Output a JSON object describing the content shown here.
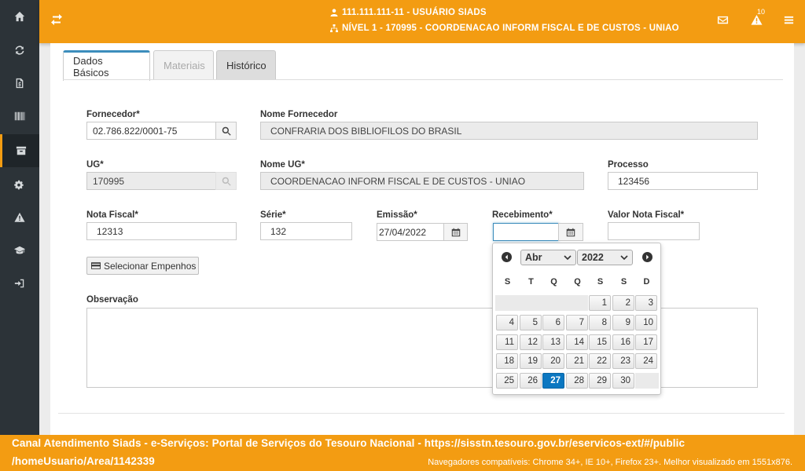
{
  "colors": {
    "header": "#f39c12",
    "sidebar": "#2c3338",
    "accent": "#3c8dbc",
    "today": "#0b77c1"
  },
  "sidebar": {
    "items": [
      {
        "icon": "home-icon"
      },
      {
        "icon": "refresh-icon"
      },
      {
        "icon": "document-money-icon"
      },
      {
        "icon": "barcode-icon"
      },
      {
        "icon": "archive-box-icon",
        "active": true
      },
      {
        "icon": "cogs-icon"
      },
      {
        "icon": "warning-icon"
      },
      {
        "icon": "graduation-cap-icon"
      },
      {
        "icon": "sign-in-icon"
      }
    ]
  },
  "header": {
    "user_line": "111.111.111-11 - USUÁRIO SIADS",
    "level_line": "NÍVEL 1 - 170995 - COORDENACAO INFORM FISCAL E DE CUSTOS - UNIAO",
    "alert_count": "10"
  },
  "tabs": [
    {
      "label": "Dados Básicos",
      "state": "active"
    },
    {
      "label": "Materiais",
      "state": "disabled"
    },
    {
      "label": "Histórico",
      "state": "normal"
    }
  ],
  "form": {
    "fornecedor": {
      "label": "Fornecedor*",
      "value": "02.786.822/0001-75"
    },
    "nome_fornecedor": {
      "label": "Nome Fornecedor",
      "value": "CONFRARIA DOS BIBLIOFILOS DO BRASIL"
    },
    "ug": {
      "label": "UG*",
      "value": "170995"
    },
    "nome_ug": {
      "label": "Nome UG*",
      "value": "COORDENACAO INFORM FISCAL E DE CUSTOS - UNIAO"
    },
    "processo": {
      "label": "Processo",
      "value": "123456"
    },
    "nota_fiscal": {
      "label": "Nota Fiscal*",
      "value": "12313"
    },
    "serie": {
      "label": "Série*",
      "value": "132"
    },
    "emissao": {
      "label": "Emissão*",
      "value": "27/04/2022"
    },
    "recebimento": {
      "label": "Recebimento*",
      "value": ""
    },
    "valor_nota": {
      "label": "Valor Nota Fiscal*",
      "value": ""
    },
    "selecionar_empenhos": "Selecionar Empenhos",
    "observacao": {
      "label": "Observação",
      "value": ""
    }
  },
  "datepicker": {
    "month": "Abr",
    "year": "2022",
    "weekdays": [
      "S",
      "T",
      "Q",
      "Q",
      "S",
      "S",
      "D"
    ],
    "leading_blanks": 4,
    "days": [
      "1",
      "2",
      "3",
      "4",
      "5",
      "6",
      "7",
      "8",
      "9",
      "10",
      "11",
      "12",
      "13",
      "14",
      "15",
      "16",
      "17",
      "18",
      "19",
      "20",
      "21",
      "22",
      "23",
      "24",
      "25",
      "26",
      "27",
      "28",
      "29",
      "30"
    ],
    "today": "27"
  },
  "footer": {
    "line1": "Canal Atendimento Siads - e-Serviços: Portal de Serviços do Tesouro Nacional - https://sisstn.tesouro.gov.br/eservicos-ext/#/public",
    "line2": "/homeUsuario/Area/1142339",
    "compat": "Navegadores compatíveis: Chrome 34+, IE 10+, Firefox 23+. Melhor visualizado em 1551x876."
  }
}
